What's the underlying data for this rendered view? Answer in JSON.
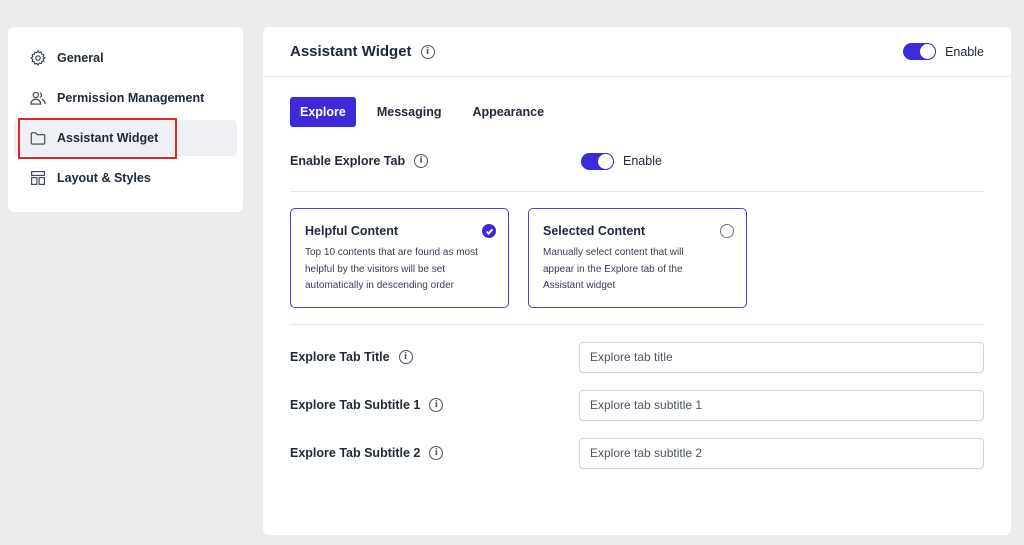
{
  "sidebar": {
    "items": [
      {
        "label": "General",
        "icon": "gear-icon"
      },
      {
        "label": "Permission Management",
        "icon": "users-icon"
      },
      {
        "label": "Assistant Widget",
        "icon": "folder-icon"
      },
      {
        "label": "Layout & Styles",
        "icon": "layout-icon"
      }
    ]
  },
  "header": {
    "title": "Assistant Widget",
    "toggle_label": "Enable"
  },
  "tabs": [
    {
      "label": "Explore",
      "active": true
    },
    {
      "label": "Messaging",
      "active": false
    },
    {
      "label": "Appearance",
      "active": false
    }
  ],
  "explore": {
    "label": "Enable Explore Tab",
    "toggle_label": "Enable"
  },
  "cards": [
    {
      "title": "Helpful Content",
      "line1": "Top 10 contents that are found as most",
      "line2": "helpful by the visitors will be set",
      "line3": "automatically in descending order",
      "selected": true
    },
    {
      "title": "Selected Content",
      "line1": "Manually select content that will",
      "line2": "appear in the Explore tab of the",
      "line3": "Assistant widget",
      "selected": false
    }
  ],
  "fields": [
    {
      "label": "Explore Tab Title",
      "placeholder": "Explore tab title"
    },
    {
      "label": "Explore Tab Subtitle 1",
      "placeholder": "Explore tab subtitle 1"
    },
    {
      "label": "Explore Tab Subtitle 2",
      "placeholder": "Explore tab subtitle 2"
    }
  ],
  "colors": {
    "accent": "#3b2bd9",
    "highlight_border": "#e0252b"
  }
}
